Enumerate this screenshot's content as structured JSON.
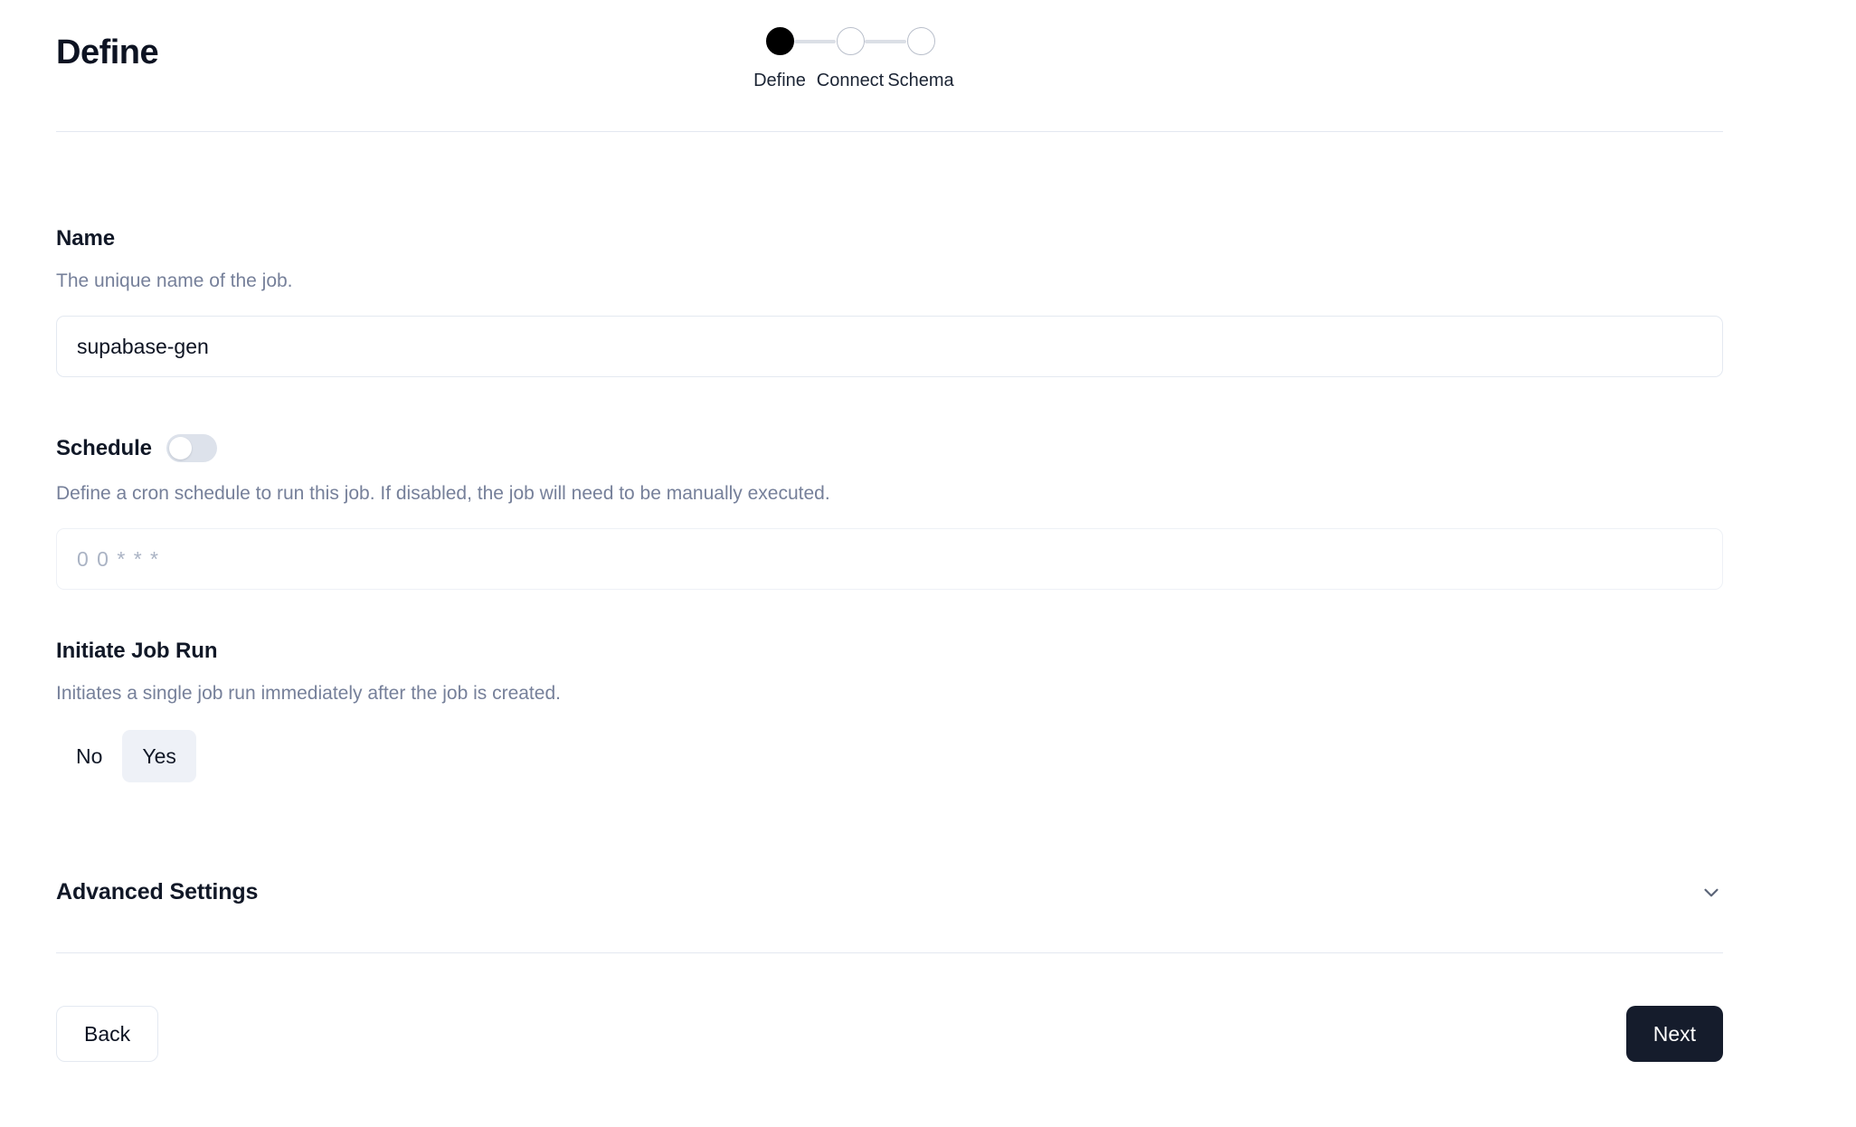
{
  "header": {
    "title": "Define"
  },
  "stepper": {
    "steps": [
      {
        "label": "Define",
        "state": "active"
      },
      {
        "label": "Connect",
        "state": "inactive"
      },
      {
        "label": "Schema",
        "state": "inactive"
      }
    ]
  },
  "fields": {
    "name": {
      "label": "Name",
      "help": "The unique name of the job.",
      "value": "supabase-gen",
      "placeholder": ""
    },
    "schedule": {
      "label": "Schedule",
      "help": "Define a cron schedule to run this job. If disabled, the job will need to be manually executed.",
      "toggle_on": false,
      "value": "",
      "placeholder": "0 0 * * *"
    },
    "initiate_job_run": {
      "label": "Initiate Job Run",
      "help": "Initiates a single job run immediately after the job is created.",
      "options": [
        {
          "label": "No",
          "selected": false
        },
        {
          "label": "Yes",
          "selected": true
        }
      ]
    }
  },
  "advanced": {
    "title": "Advanced Settings",
    "icon": "chevron-down-icon",
    "expanded": false
  },
  "footer": {
    "back_label": "Back",
    "next_label": "Next"
  },
  "colors": {
    "accent_dark": "#151c2c",
    "step_active": "#000000",
    "divider": "#e3e8f0",
    "muted_text": "#76809a",
    "segment_selected_bg": "#eef1f7"
  }
}
